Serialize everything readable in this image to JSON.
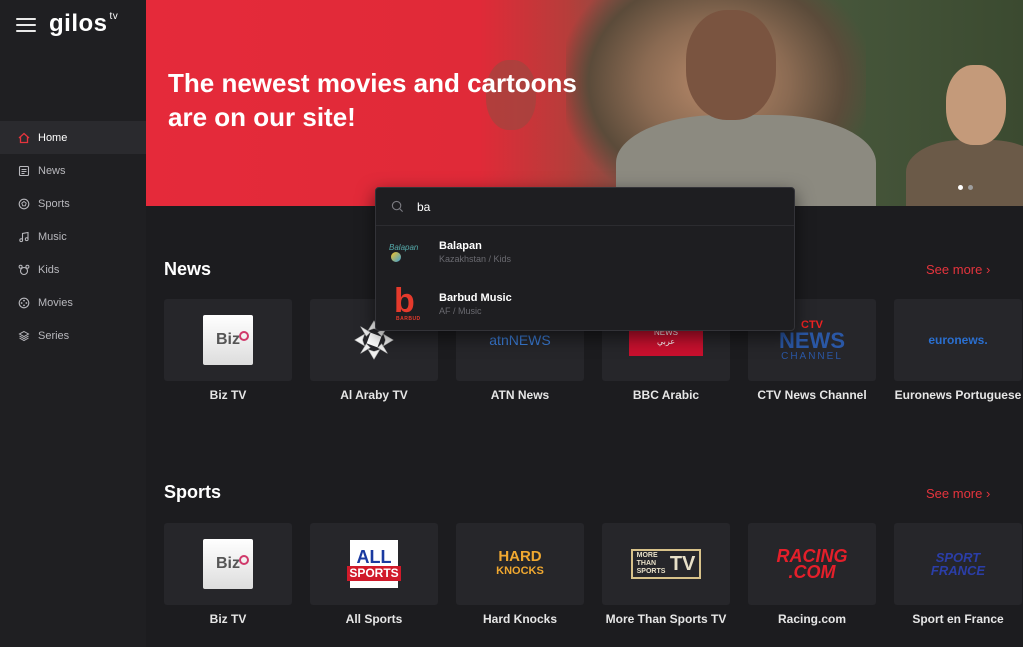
{
  "brand": {
    "name": "gilos",
    "suffix": "tv"
  },
  "sidebar": {
    "items": [
      {
        "label": "Home",
        "icon": "home-icon",
        "active": true
      },
      {
        "label": "News",
        "icon": "news-icon",
        "active": false
      },
      {
        "label": "Sports",
        "icon": "sports-icon",
        "active": false
      },
      {
        "label": "Music",
        "icon": "music-icon",
        "active": false
      },
      {
        "label": "Kids",
        "icon": "kids-icon",
        "active": false
      },
      {
        "label": "Movies",
        "icon": "movies-icon",
        "active": false
      },
      {
        "label": "Series",
        "icon": "series-icon",
        "active": false
      }
    ]
  },
  "hero": {
    "title_line1": "The newest movies and cartoons",
    "title_line2": "are on our site!",
    "slides": 2,
    "active_slide": 1
  },
  "search": {
    "query": "ba",
    "results": [
      {
        "title": "Balapan",
        "subtitle": "Kazakhstan / Kids",
        "logo_text": "Balapan"
      },
      {
        "title": "Barbud Music",
        "subtitle": "AF / Music",
        "logo_text": "BARBUD"
      }
    ]
  },
  "sections": {
    "news": {
      "title": "News",
      "see_more": "See more ›",
      "channels": [
        {
          "name": "Biz TV",
          "logo": "Biz"
        },
        {
          "name": "Al Araby TV",
          "logo": ""
        },
        {
          "name": "ATN News",
          "logo_a": "atn",
          "logo_b": "NEWS"
        },
        {
          "name": "BBC Arabic",
          "logo_a": "NEWS",
          "logo_b": "عربي"
        },
        {
          "name": "CTV News Channel",
          "logo_a": "CTV",
          "logo_b": "NEWS",
          "logo_c": "CHANNEL"
        },
        {
          "name": "Euronews Portuguese",
          "logo": "euronews."
        }
      ]
    },
    "sports": {
      "title": "Sports",
      "see_more": "See more ›",
      "channels": [
        {
          "name": "Biz TV",
          "logo": "Biz"
        },
        {
          "name": "All Sports",
          "logo_a": "ALL",
          "logo_b": "SPORTS"
        },
        {
          "name": "Hard Knocks",
          "logo_a": "HARD",
          "logo_b": "KNOCKS"
        },
        {
          "name": "More Than Sports TV",
          "logo_a": "MORE THAN SPORTS",
          "logo_b": "TV"
        },
        {
          "name": "Racing.com",
          "logo_a": "RACING",
          "logo_b": ".COM"
        },
        {
          "name": "Sport en France",
          "logo_a": "SPORT",
          "logo_b": "FRANCE"
        }
      ]
    }
  },
  "colors": {
    "accent": "#e5343d",
    "hero_red": "#e52a3a",
    "background": "#1c1c1f",
    "sidebar": "#1f1f22"
  }
}
